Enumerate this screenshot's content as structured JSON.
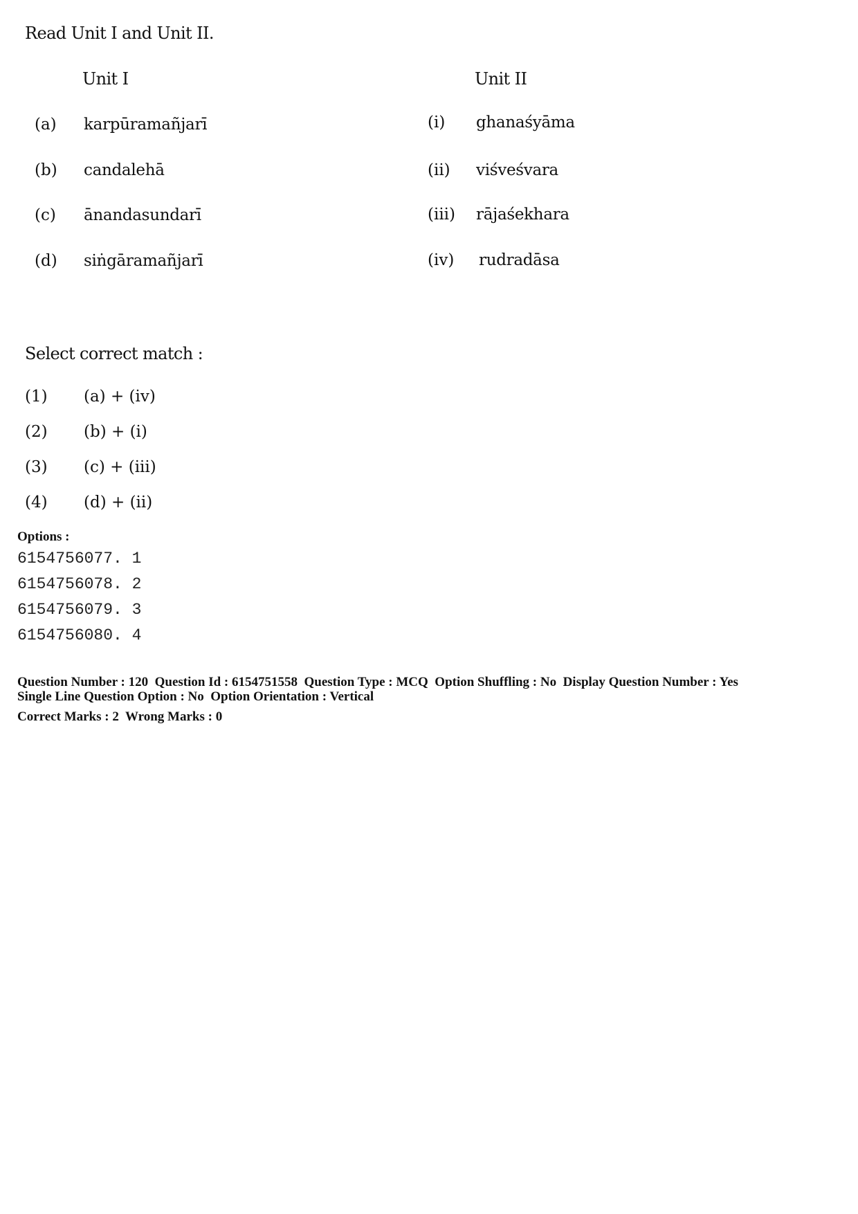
{
  "question": {
    "intro": "Read Unit I and Unit II.",
    "unit1": {
      "heading": "Unit I",
      "items": [
        {
          "label": "(a)",
          "text": "karpūramañjarī"
        },
        {
          "label": "(b)",
          "text": "candalehā"
        },
        {
          "label": "(c)",
          "text": "ānandasundarī"
        },
        {
          "label": "(d)",
          "text": "siṅgāramañjarī"
        }
      ]
    },
    "unit2": {
      "heading": "Unit II",
      "items": [
        {
          "label": "(i)",
          "text": "ghanaśyāma"
        },
        {
          "label": "(ii)",
          "text": "viśveśvara"
        },
        {
          "label": "(iii)",
          "text": "rājaśekhara"
        },
        {
          "label": "(iv)",
          "text": "rudradāsa"
        }
      ]
    },
    "prompt": "Select correct match :",
    "choices": [
      {
        "label": "(1)",
        "text": "(a) + (iv)"
      },
      {
        "label": "(2)",
        "text": "(b) + (i)"
      },
      {
        "label": "(3)",
        "text": "(c) + (iii)"
      },
      {
        "label": "(4)",
        "text": "(d) + (ii)"
      }
    ]
  },
  "options": {
    "heading": "Options :",
    "items": [
      "6154756077. 1",
      "6154756078. 2",
      "6154756079. 3",
      "6154756080. 4"
    ]
  },
  "next_question_meta": {
    "line1": "Question Number : 120  Question Id : 6154751558  Question Type : MCQ  Option Shuffling : No  Display Question Number : Yes",
    "line2": "Single Line Question Option : No  Option Orientation : Vertical",
    "line3": "Correct Marks : 2  Wrong Marks : 0"
  }
}
